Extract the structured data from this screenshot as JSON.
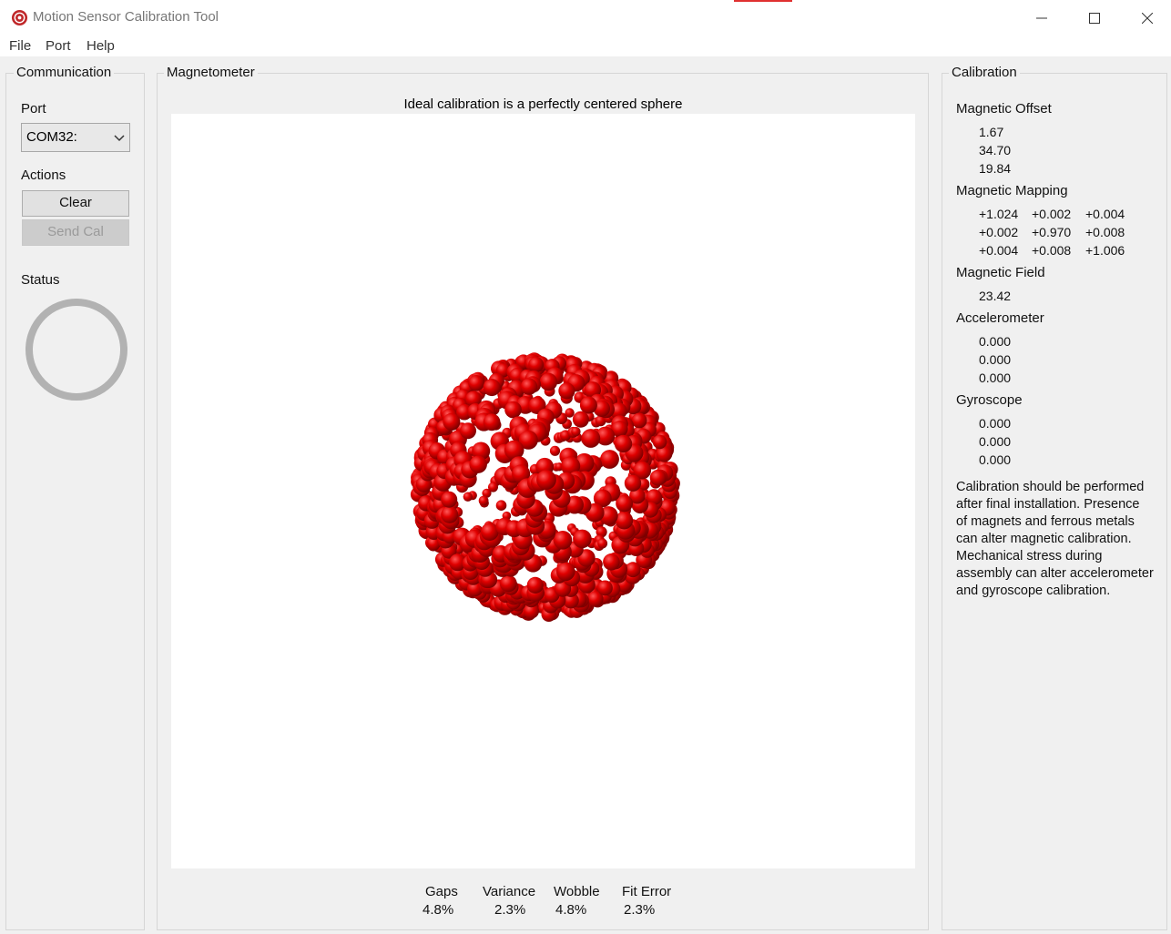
{
  "window": {
    "title": "Motion Sensor Calibration Tool"
  },
  "menu": [
    "File",
    "Port",
    "Help"
  ],
  "communication": {
    "group_title": "Communication",
    "port_label": "Port",
    "port_value": "COM32:",
    "actions_label": "Actions",
    "clear_label": "Clear",
    "send_cal_label": "Send Cal",
    "status_label": "Status"
  },
  "magnetometer": {
    "group_title": "Magnetometer",
    "heading": "Ideal calibration is a perfectly centered sphere",
    "sphere_color": "#e00000",
    "stats": [
      {
        "label": "Gaps",
        "value": "4.8%"
      },
      {
        "label": "Variance",
        "value": "2.3%"
      },
      {
        "label": "Wobble",
        "value": "4.8%"
      },
      {
        "label": "Fit Error",
        "value": "2.3%"
      }
    ]
  },
  "calibration": {
    "group_title": "Calibration",
    "offset_label": "Magnetic Offset",
    "offset": [
      "1.67",
      "34.70",
      "19.84"
    ],
    "mapping_label": "Magnetic Mapping",
    "mapping": [
      [
        "+1.024",
        "+0.002",
        "+0.004"
      ],
      [
        "+0.002",
        "+0.970",
        "+0.008"
      ],
      [
        "+0.004",
        "+0.008",
        "+1.006"
      ]
    ],
    "field_label": "Magnetic Field",
    "field": "23.42",
    "accel_label": "Accelerometer",
    "accel": [
      "0.000",
      "0.000",
      "0.000"
    ],
    "gyro_label": "Gyroscope",
    "gyro": [
      "0.000",
      "0.000",
      "0.000"
    ],
    "note_lines": [
      "Calibration should be performed",
      "after final installation.  Presence",
      "of magnets and ferrous metals",
      "can alter magnetic calibration.",
      "Mechanical stress during",
      "assembly can alter accelerometer",
      "and gyroscope calibration."
    ]
  }
}
